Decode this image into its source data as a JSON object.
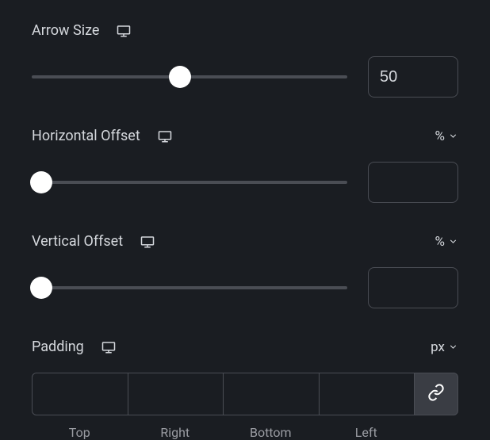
{
  "arrowSize": {
    "label": "Arrow Size",
    "value": "50",
    "thumbPosition": "47%"
  },
  "horizontalOffset": {
    "label": "Horizontal Offset",
    "unit": "%",
    "value": "",
    "thumbPosition": "3%"
  },
  "verticalOffset": {
    "label": "Vertical Offset",
    "unit": "%",
    "value": "",
    "thumbPosition": "3%"
  },
  "padding": {
    "label": "Padding",
    "unit": "px",
    "top": {
      "label": "Top",
      "value": ""
    },
    "right": {
      "label": "Right",
      "value": ""
    },
    "bottom": {
      "label": "Bottom",
      "value": ""
    },
    "left": {
      "label": "Left",
      "value": ""
    }
  }
}
